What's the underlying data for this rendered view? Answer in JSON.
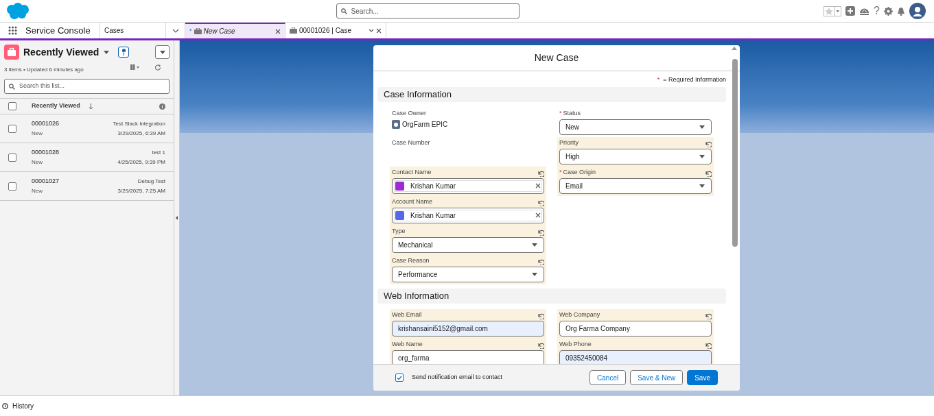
{
  "header": {
    "search_placeholder": "Search...",
    "help_glyph": "?"
  },
  "app": {
    "name": "Service Console",
    "object_tab": "Cases"
  },
  "tabs": [
    {
      "label": "New Case",
      "prefix": "*",
      "unsaved": true,
      "selected": true,
      "has_menu": false
    },
    {
      "label": "00001026 | Case",
      "unsaved": false,
      "selected": false,
      "has_menu": true
    }
  ],
  "list": {
    "title": "Recently Viewed",
    "meta": "3 items • Updated 6 minutes ago",
    "search_placeholder": "Search this list...",
    "column": "Recently Viewed",
    "all_checked": false,
    "rows": [
      {
        "number": "00001026",
        "status": "New",
        "subject": "Test Slack Integration",
        "date": "3/29/2025, 6:39 AM",
        "checked": false
      },
      {
        "number": "00001028",
        "status": "New",
        "subject": "test 1",
        "date": "4/25/2025, 9:39 PM",
        "checked": false
      },
      {
        "number": "00001027",
        "status": "New",
        "subject": "Debug Test",
        "date": "3/29/2025, 7:25 AM",
        "checked": false
      }
    ]
  },
  "modal": {
    "title": "New Case",
    "required_mark": "*",
    "required_note": "= Required Information",
    "sections": [
      {
        "title": "Case Information",
        "left_fields": [
          {
            "kind": "owner",
            "label": "Case Owner",
            "value": "OrgFarm EPIC",
            "required": false,
            "edited": false
          },
          {
            "kind": "readonly",
            "label": "Case Number",
            "required": false,
            "edited": false
          },
          {
            "kind": "lookup",
            "label": "Contact Name",
            "value": "Krishan Kumar",
            "color": "#9c2bd1",
            "required": false,
            "edited": true
          },
          {
            "kind": "lookup",
            "label": "Account Name",
            "value": "Krishan Kumar",
            "color": "#5867e8",
            "required": false,
            "edited": true
          },
          {
            "kind": "picklist",
            "label": "Type",
            "value": "Mechanical",
            "required": false,
            "edited": true
          },
          {
            "kind": "picklist",
            "label": "Case Reason",
            "value": "Performance",
            "required": false,
            "edited": true
          }
        ],
        "right_fields": [
          {
            "kind": "picklist",
            "label": "Status",
            "value": "New",
            "required": true,
            "edited": false
          },
          {
            "kind": "picklist",
            "label": "Priority",
            "value": "High",
            "required": false,
            "edited": true
          },
          {
            "kind": "picklist",
            "label": "Case Origin",
            "value": "Email",
            "required": true,
            "edited": true
          }
        ]
      },
      {
        "title": "Web Information",
        "left_fields": [
          {
            "kind": "text",
            "label": "Web Email",
            "value": "krishansaini5152@gmail.com",
            "autofilled": true,
            "required": false,
            "edited": true
          },
          {
            "kind": "text",
            "label": "Web Name",
            "value": "org_farma",
            "autofilled": false,
            "required": false,
            "edited": true
          }
        ],
        "right_fields": [
          {
            "kind": "text",
            "label": "Web Company",
            "value": "Org Farma Company",
            "autofilled": false,
            "required": false,
            "edited": true
          },
          {
            "kind": "text",
            "label": "Web Phone",
            "value": "09352450084",
            "autofilled": true,
            "required": false,
            "edited": true
          }
        ]
      }
    ],
    "notify": {
      "label": "Send notification email to contact",
      "checked": true
    },
    "buttons": [
      {
        "label": "Cancel",
        "kind": "neutral"
      },
      {
        "label": "Save & New",
        "kind": "neutral"
      },
      {
        "label": "Save",
        "kind": "brand"
      }
    ]
  },
  "footer": {
    "history": "History"
  }
}
